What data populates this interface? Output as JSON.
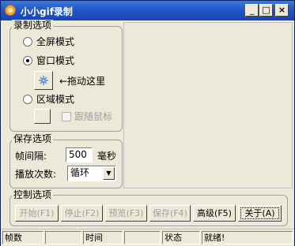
{
  "window": {
    "title": "小小gif录制"
  },
  "titlebar": {
    "minimize_glyph": "_",
    "maximize_glyph": "□",
    "close_glyph": "×"
  },
  "record_options": {
    "label": "录制选项",
    "fullscreen_mode": "全屏模式",
    "window_mode": "窗口模式",
    "drag_hint": "←拖动这里",
    "region_mode": "区域模式",
    "follow_mouse": "跟随鼠标",
    "selected_mode": "窗口模式"
  },
  "save_options": {
    "label": "保存选项",
    "frame_interval_label": "帧间隔:",
    "frame_interval_value": "500",
    "frame_interval_unit": "毫秒",
    "play_count_label": "播放次数:",
    "play_count_value": "循环"
  },
  "control_options": {
    "label": "控制选项",
    "start": "开始(F1)",
    "stop": "停止(F2)",
    "preview": "预览(F3)",
    "save": "保存(F4)",
    "advanced": "高级(F5)",
    "about": "关于(A)"
  },
  "statusbar": {
    "frames_label": "帧数",
    "frames_value": "",
    "time_label": "时间",
    "time_value": "",
    "state_label": "状态",
    "state_value": "就绪!"
  },
  "colors": {
    "titlebar": "#2156c8",
    "face": "#ece9d8",
    "disabled_text": "#a0a0a0"
  }
}
